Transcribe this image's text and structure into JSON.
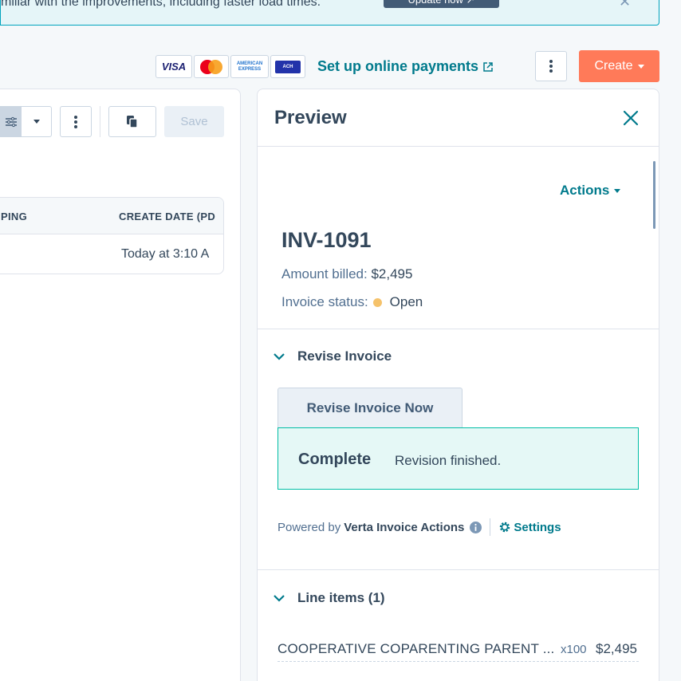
{
  "banner": {
    "text": "miliar with the improvements, including faster load times.",
    "button_label": "Update now ↗",
    "close_label": "✕"
  },
  "payments": {
    "cards": [
      "VISA",
      "mastercard",
      "AMERICAN EXPRESS",
      "ACH"
    ],
    "link_label": "Set up online payments"
  },
  "toolbar": {
    "create_label": "Create",
    "save_label": "Save"
  },
  "table": {
    "columns": [
      "PING",
      "CREATE DATE (PD"
    ],
    "rows": [
      {
        "create_date": "Today at 3:10 A"
      }
    ]
  },
  "preview": {
    "title": "Preview",
    "actions_label": "Actions",
    "invoice_number": "INV-1091",
    "amount_label": "Amount billed:",
    "amount_value": "$2,495",
    "status_label": "Invoice status:",
    "status_value": "Open",
    "status_color": "#f5c26b",
    "revise_section": {
      "title": "Revise Invoice",
      "button_label": "Revise Invoice Now",
      "complete_title": "Complete",
      "complete_message": "Revision finished."
    },
    "powered_by": {
      "prefix": "Powered by",
      "brand": "Verta Invoice Actions",
      "settings_label": "Settings"
    },
    "line_items": {
      "title": "Line items (1)",
      "items": [
        {
          "name": "COOPERATIVE COPARENTING PARENT ...",
          "qty": "x100",
          "price": "$2,495"
        }
      ]
    }
  },
  "colors": {
    "accent": "#007a8c",
    "create": "#ff7a59",
    "success": "#00bda5"
  }
}
